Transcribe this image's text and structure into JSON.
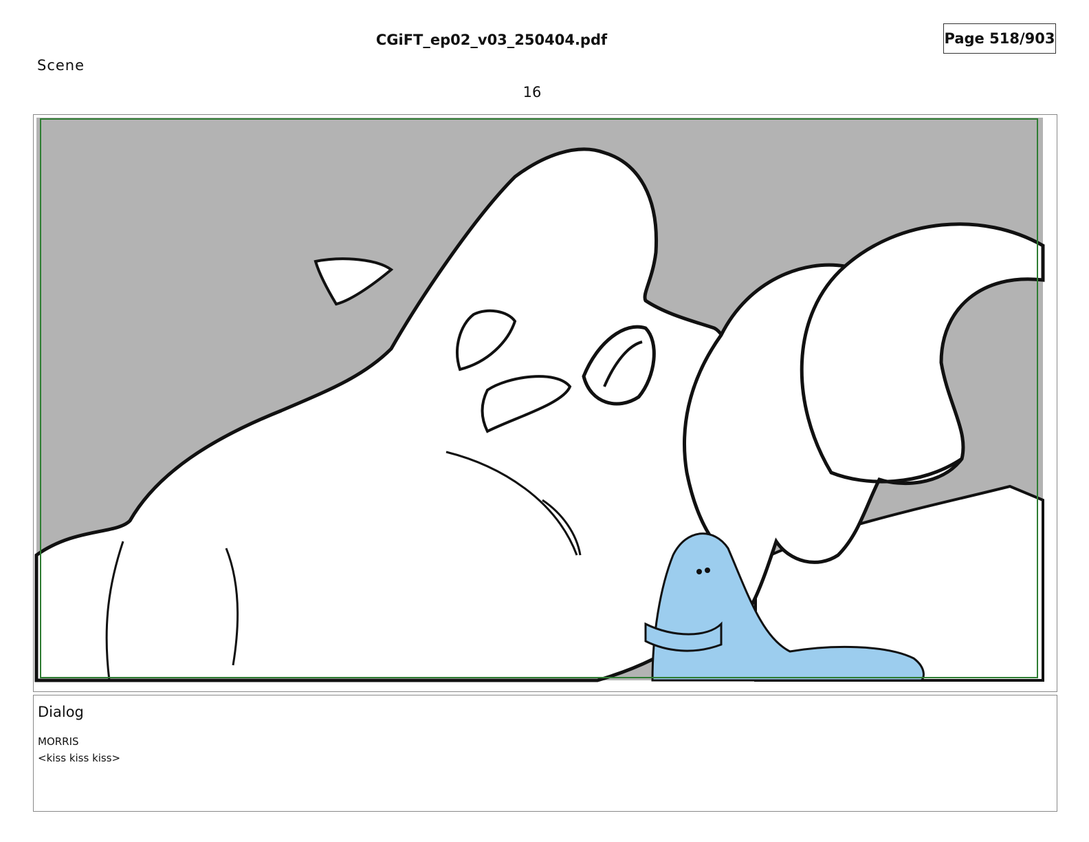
{
  "header": {
    "document_title": "CGiFT_ep02_v03_250404.pdf",
    "page_indicator": "Page 518/903"
  },
  "scene": {
    "label": "Scene",
    "number": "16"
  },
  "panel": {
    "background_color": "#b3b3b3",
    "safe_frame_color": "#2e7d32",
    "character_fill": "#ffffff",
    "small_creature_color": "#9ccdee"
  },
  "dialog": {
    "label": "Dialog",
    "speaker": "MORRIS",
    "line": "<kiss kiss kiss>"
  }
}
